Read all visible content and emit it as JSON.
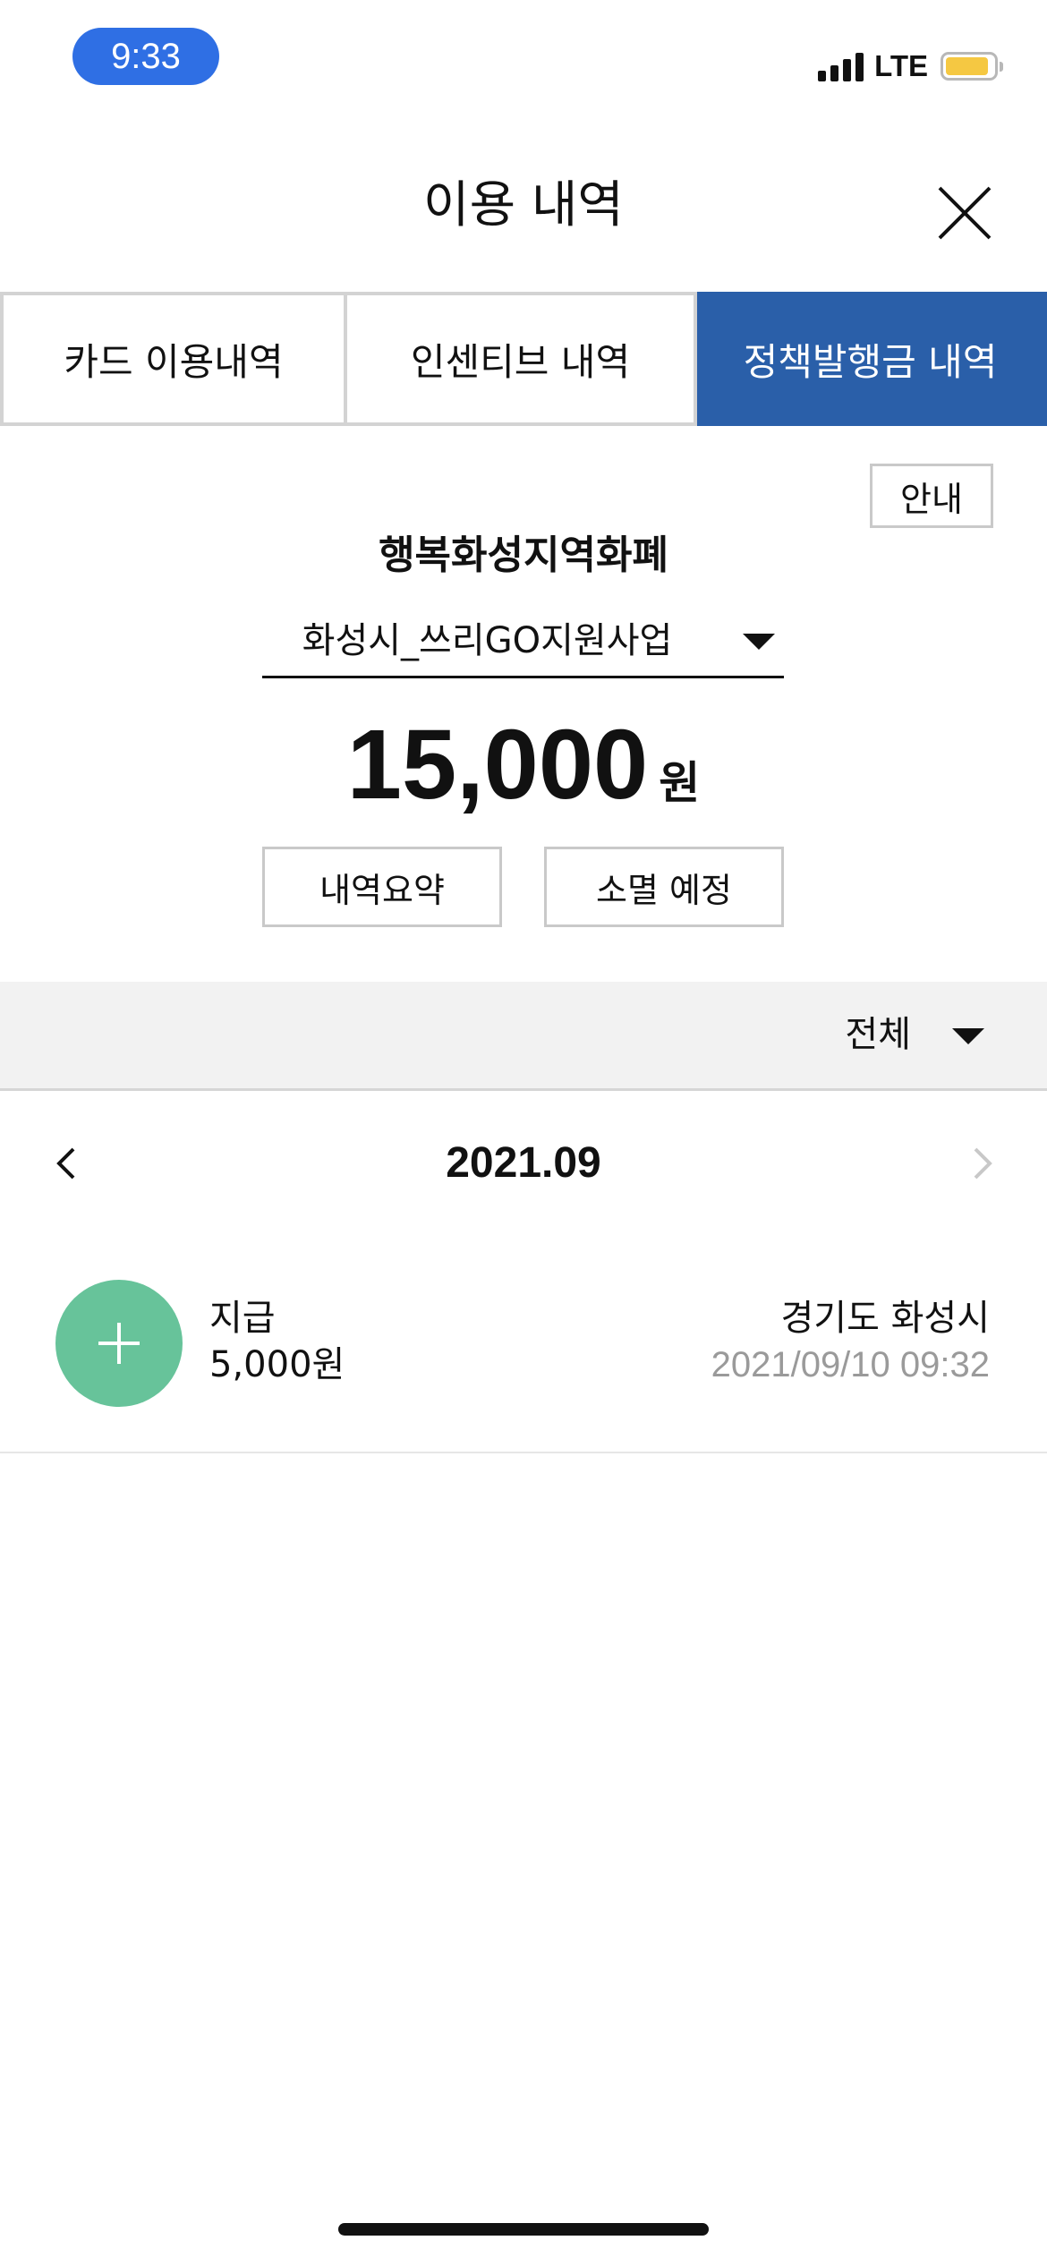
{
  "status_bar": {
    "time": "9:33",
    "network": "LTE",
    "battery_level": 0.9,
    "colors": {
      "time_pill": "#2f6fe4",
      "battery": "#f5c842"
    }
  },
  "header": {
    "title": "이용 내역",
    "close_icon": "close-icon"
  },
  "tabs": [
    {
      "label": "카드 이용내역",
      "active": false
    },
    {
      "label": "인센티브 내역",
      "active": false
    },
    {
      "label": "정책발행금 내역",
      "active": true
    }
  ],
  "info_button": {
    "label": "안내"
  },
  "currency": {
    "name": "행복화성지역화폐",
    "program": "화성시_쓰리GO지원사업",
    "balance": "15,000",
    "unit": "원"
  },
  "actions": {
    "summary": "내역요약",
    "expiry": "소멸 예정"
  },
  "filter": {
    "selected": "전체"
  },
  "month_nav": {
    "month": "2021.09",
    "prev_icon": "chevron-left-icon",
    "next_icon": "chevron-right-icon"
  },
  "transactions": [
    {
      "icon": "plus-icon",
      "type": "지급",
      "amount": "5,000원",
      "place": "경기도 화성시",
      "datetime": "2021/09/10 09:32"
    }
  ],
  "colors": {
    "accent": "#2a5fa9",
    "txn_icon": "#67c39a"
  }
}
